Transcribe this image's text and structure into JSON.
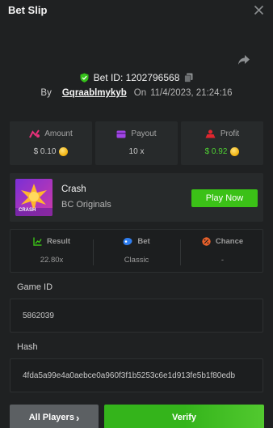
{
  "header": {
    "title": "Bet Slip"
  },
  "bet": {
    "id_label": "Bet ID: 1202796568",
    "by_label": "By",
    "user": "Gqraablmykyb",
    "on_label": "On",
    "date": "11/4/2023, 21:24:16"
  },
  "stats": {
    "amount": {
      "label": "Amount",
      "value": "$ 0.10"
    },
    "payout": {
      "label": "Payout",
      "value": "10 x"
    },
    "profit": {
      "label": "Profit",
      "value": "$ 0.92"
    }
  },
  "game": {
    "thumb_text": "CRASH",
    "name": "Crash",
    "provider": "BC Originals",
    "play_label": "Play Now"
  },
  "details": {
    "result": {
      "label": "Result",
      "value": "22.80x"
    },
    "bet": {
      "label": "Bet",
      "value": "Classic"
    },
    "chance": {
      "label": "Chance",
      "value": "-"
    }
  },
  "fields": {
    "game_id_label": "Game ID",
    "game_id_value": "5862039",
    "hash_label": "Hash",
    "hash_value": "4fda5a99e4a0aebce0a960f3f1b5253c6e1d913fe5b1f80edb"
  },
  "footer": {
    "players_label": "All Players",
    "players_chevron": "›",
    "verify_label": "Verify"
  },
  "colors": {
    "accent_green": "#3bc117",
    "profit_green": "#4fd233",
    "background": "#1f2122",
    "card": "#272a2b"
  }
}
